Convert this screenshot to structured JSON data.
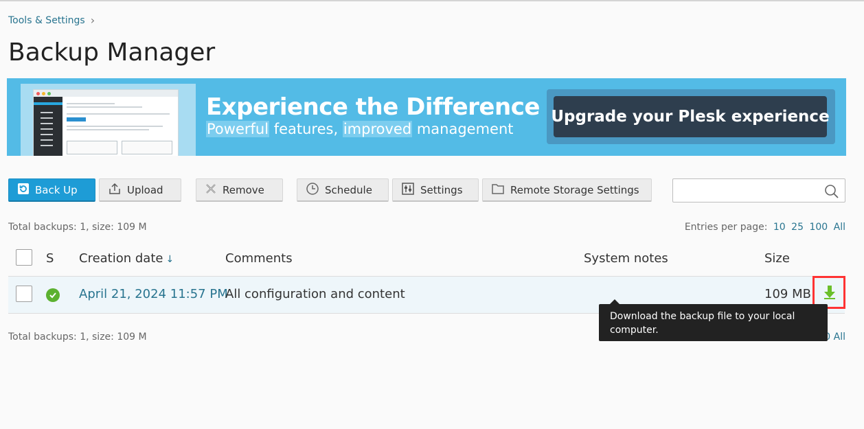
{
  "breadcrumb": {
    "label": "Tools & Settings",
    "chevron": "›"
  },
  "page": {
    "title": "Backup Manager"
  },
  "banner": {
    "headline": "Experience the Difference",
    "sub_pre": "",
    "sub_hl1": "Powerful",
    "sub_mid": " features, ",
    "sub_hl2": "improved",
    "sub_post": " management",
    "cta": "Upgrade your Plesk experience"
  },
  "toolbar": {
    "back_up": "Back Up",
    "upload": "Upload",
    "remove": "Remove",
    "schedule": "Schedule",
    "settings": "Settings",
    "remote_storage": "Remote Storage Settings",
    "search_placeholder": ""
  },
  "summary": {
    "top": "Total backups: 1, size: 109 M",
    "bottom": "Total backups: 1, size: 109 M"
  },
  "entries_per_page": {
    "label": "Entries per page:",
    "options": [
      "10",
      "25",
      "100",
      "All"
    ]
  },
  "table": {
    "headers": {
      "status": "S",
      "creation_date": "Creation date",
      "sort": "↓",
      "comments": "Comments",
      "system_notes": "System notes",
      "size": "Size"
    },
    "rows": [
      {
        "creation_date": "April 21, 2024 11:57 PM",
        "comments": "All configuration and content",
        "system_notes": "",
        "size": "109 MB",
        "status": "ok"
      }
    ]
  },
  "tooltip": {
    "text": "Download the backup file to your local computer."
  },
  "partial_visible": {
    "bottom_right": "0 All"
  },
  "colors": {
    "accent": "#1e9cd6",
    "link": "#28748f",
    "success": "#5cb130",
    "highlight_frame": "#ff3333",
    "tooltip_bg": "#222222"
  },
  "icons": {
    "back_up": "backup-icon",
    "upload": "upload-icon",
    "remove": "remove-x-icon",
    "schedule": "clock-icon",
    "settings": "sliders-icon",
    "remote_storage": "folder-icon",
    "search": "search-icon",
    "download": "download-arrow-icon",
    "status": "check-circle-icon"
  }
}
